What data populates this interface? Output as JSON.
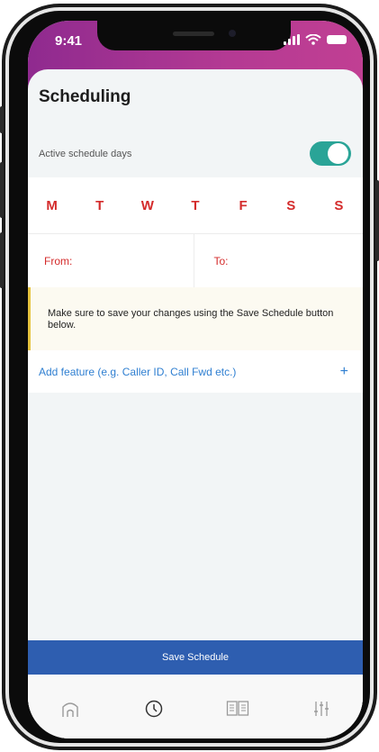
{
  "status_bar": {
    "time": "9:41"
  },
  "page": {
    "title": "Scheduling"
  },
  "active_days": {
    "label": "Active schedule days",
    "enabled": true
  },
  "days": [
    "M",
    "T",
    "W",
    "T",
    "F",
    "S",
    "S"
  ],
  "range": {
    "from_label": "From:",
    "to_label": "To:"
  },
  "notice": {
    "text": "Make sure to save your changes using the Save Schedule button below."
  },
  "add_feature": {
    "label": "Add feature (e.g. Caller ID, Call Fwd etc.)",
    "icon": "plus-icon"
  },
  "save_button": {
    "label": "Save Schedule"
  },
  "tabs": [
    {
      "icon": "home-icon"
    },
    {
      "icon": "clock-icon"
    },
    {
      "icon": "book-icon"
    },
    {
      "icon": "sliders-icon"
    }
  ],
  "colors": {
    "header_gradient_start": "#8f2a8f",
    "header_gradient_end": "#c13f93",
    "day_red": "#d42b2b",
    "toggle_teal": "#2aa497",
    "link_blue": "#2f7fd1",
    "save_blue": "#2e5eb0"
  }
}
